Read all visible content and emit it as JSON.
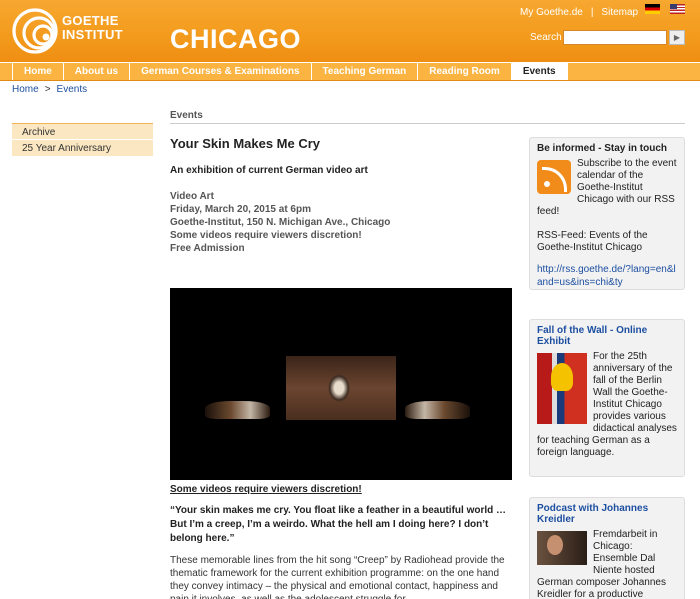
{
  "header": {
    "logo_line1": "GOETHE",
    "logo_line2": "INSTITUT",
    "city": "CHICAGO",
    "my_goethe": "My Goethe.de",
    "sitemap": "Sitemap",
    "search_label": "Search",
    "search_value": "",
    "search_go": "▶",
    "brand_color": "#f39a1c"
  },
  "nav": {
    "items": [
      "Home",
      "About us",
      "German Courses & Examinations",
      "Teaching German",
      "Reading Room",
      "Events"
    ],
    "active": "Events"
  },
  "breadcrumb": {
    "home": "Home",
    "sep": ">",
    "current": "Events"
  },
  "sidebar": {
    "items": [
      "Archive",
      "25 Year Anniversary"
    ]
  },
  "main": {
    "section_title": "Events",
    "title": "Your Skin Makes Me Cry",
    "subtitle": "An exhibition of current German video art",
    "meta": [
      "Video Art",
      "Friday, March 20, 2015 at 6pm",
      "Goethe-Institut, 150 N. Michigan Ave., Chicago",
      "Some videos require viewers discretion!",
      "Free Admission"
    ],
    "discretion_link": "Some videos require viewers discretion!",
    "quote": "“Your skin makes me cry. You float like a feather in a beautiful world … But I’m a creep, I’m a weirdo. What the hell am I doing here? I don’t belong here.”",
    "body": "These memorable lines from the hit song “Creep” by Radiohead provide the thematic framework for the current exhibition programme: on the one hand they convey intimacy – the physical and emotional contact, happiness and pain it involves, as well as the adolescent struggle for"
  },
  "right": {
    "box1": {
      "title": "Be informed - Stay in touch",
      "text": "Subscribe to the event calendar of the Goethe-Institut Chicago with our RSS feed!",
      "feed_label": "RSS-Feed: Events of the Goethe-Institut Chicago",
      "feed_url": "http://rss.goethe.de/?lang=en&land=us&ins=chi&ty"
    },
    "box2": {
      "title": "Fall of the Wall - Online Exhibit",
      "text": "For the 25th anniversary of the fall of the Berlin Wall the Goethe-Institut Chicago provides various didactical analyses for teaching German as a foreign language."
    },
    "box3": {
      "title": "Podcast with Johannes Kreidler",
      "text": "Fremdarbeit in Chicago: Ensemble Dal Niente hosted German composer Johannes Kreidler for a productive collaboration"
    }
  }
}
